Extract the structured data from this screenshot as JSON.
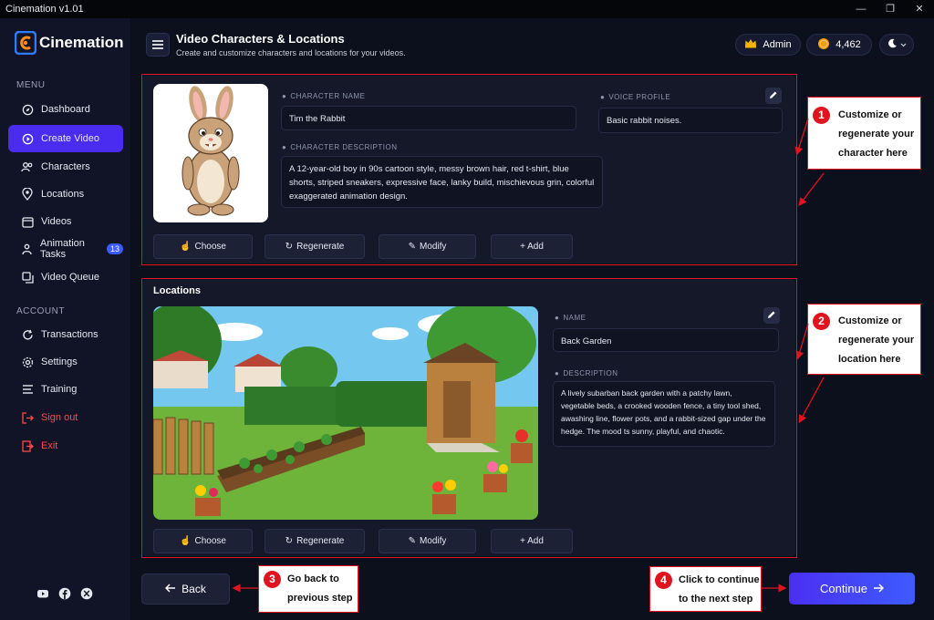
{
  "window": {
    "title": "Cinemation v1.01"
  },
  "brand": {
    "name": "Cinemation"
  },
  "sidebar": {
    "menu_label": "MENU",
    "account_label": "ACCOUNT",
    "items": [
      {
        "label": "Dashboard",
        "icon": "compass-icon"
      },
      {
        "label": "Create Video",
        "icon": "play-icon",
        "active": true
      },
      {
        "label": "Characters",
        "icon": "users-icon"
      },
      {
        "label": "Locations",
        "icon": "map-pin-icon"
      },
      {
        "label": "Videos",
        "icon": "calendar-icon"
      },
      {
        "label": "Animation Tasks",
        "icon": "person-icon",
        "badge": "13"
      },
      {
        "label": "Video Queue",
        "icon": "queue-icon"
      }
    ],
    "account_items": [
      {
        "label": "Transactions",
        "icon": "refresh-icon"
      },
      {
        "label": "Settings",
        "icon": "gear-icon"
      },
      {
        "label": "Training",
        "icon": "list-icon"
      },
      {
        "label": "Sign out",
        "icon": "sign-out-icon"
      },
      {
        "label": "Exit",
        "icon": "exit-icon"
      }
    ]
  },
  "header": {
    "title": "Video Characters & Locations",
    "subtitle": "Create and customize characters and locations for your videos.",
    "user_label": "Admin",
    "credits": "4,462"
  },
  "character": {
    "name_label": "CHARACTER NAME",
    "name_value": "Tim the Rabbit",
    "voice_label": "VOICE PROFILE",
    "voice_value": "Basic rabbit noises.",
    "desc_label": "CHARACTER DESCRIPTION",
    "desc_value": "A 12-year-old boy in 90s cartoon style, messy brown hair, red t-shirt, blue shorts, striped sneakers, expressive face, lanky build, mischievous grin, colorful exaggerated animation design."
  },
  "locations": {
    "section_title": "Locations",
    "name_label": "NAME",
    "name_value": "Back Garden",
    "desc_label": "DESCRIPTION",
    "desc_value": "A lively subarban back garden with a patchy lawn, vegetable beds, a crooked wooden fence, a tiny tool shed, awashing line, flower pots, and a rabbit-sized gap under the hedge. The mood ts sunny, playful, and chaotic."
  },
  "actions": {
    "choose": "Choose",
    "regenerate": "Regenerate",
    "modify": "Modify",
    "add": "+ Add"
  },
  "footer": {
    "back": "Back",
    "continue": "Continue"
  },
  "callouts": [
    {
      "num": "1",
      "lines": [
        "Customize or",
        "regenerate your",
        "character here"
      ]
    },
    {
      "num": "2",
      "lines": [
        "Customize or",
        "regenerate your",
        "location here"
      ]
    },
    {
      "num": "3",
      "lines": [
        "Go back to",
        "previous step"
      ]
    },
    {
      "num": "4",
      "lines": [
        "Click to continue",
        "to the next step"
      ]
    }
  ],
  "colors": {
    "accent": "#4a2cf0",
    "annotation": "#e0141e",
    "danger": "#ff4a4a"
  }
}
